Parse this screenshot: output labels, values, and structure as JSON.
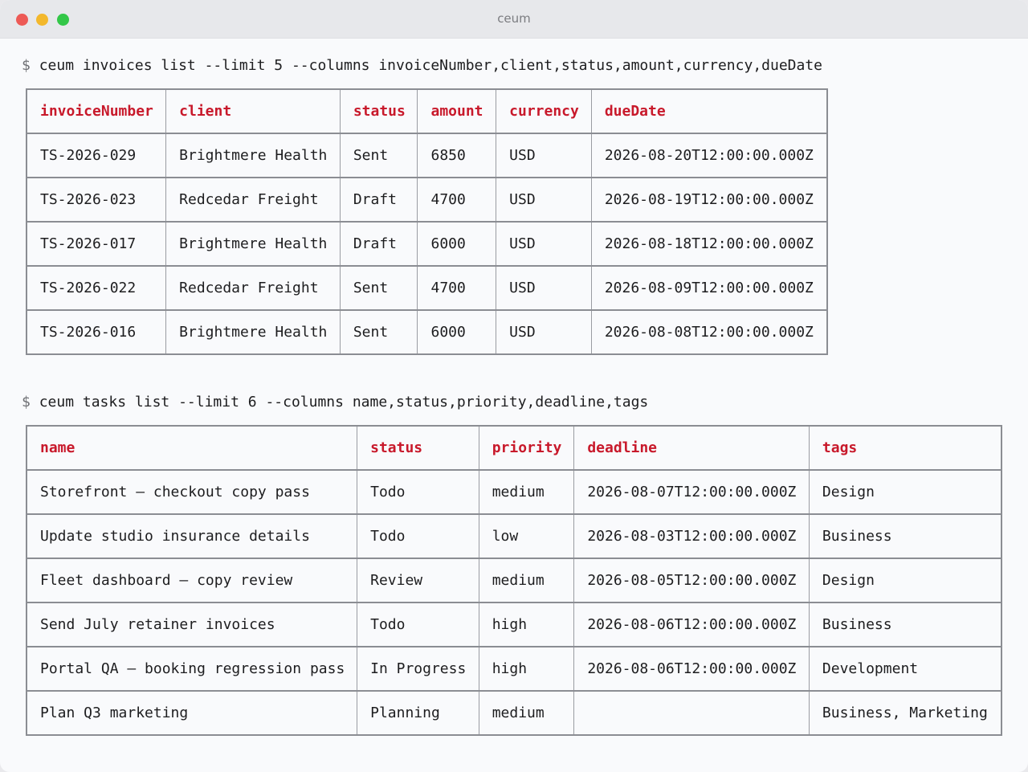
{
  "window": {
    "title": "ceum"
  },
  "commands": [
    {
      "prompt": "$",
      "command": "ceum invoices list --limit 5 --columns invoiceNumber,client,status,amount,currency,dueDate",
      "columns": [
        "invoiceNumber",
        "client",
        "status",
        "amount",
        "currency",
        "dueDate"
      ],
      "rows": [
        [
          "TS-2026-029",
          "Brightmere Health",
          "Sent",
          "6850",
          "USD",
          "2026-08-20T12:00:00.000Z"
        ],
        [
          "TS-2026-023",
          "Redcedar Freight",
          "Draft",
          "4700",
          "USD",
          "2026-08-19T12:00:00.000Z"
        ],
        [
          "TS-2026-017",
          "Brightmere Health",
          "Draft",
          "6000",
          "USD",
          "2026-08-18T12:00:00.000Z"
        ],
        [
          "TS-2026-022",
          "Redcedar Freight",
          "Sent",
          "4700",
          "USD",
          "2026-08-09T12:00:00.000Z"
        ],
        [
          "TS-2026-016",
          "Brightmere Health",
          "Sent",
          "6000",
          "USD",
          "2026-08-08T12:00:00.000Z"
        ]
      ]
    },
    {
      "prompt": "$",
      "command": "ceum tasks list --limit 6 --columns name,status,priority,deadline,tags",
      "columns": [
        "name",
        "status",
        "priority",
        "deadline",
        "tags"
      ],
      "rows": [
        [
          "Storefront — checkout copy pass",
          "Todo",
          "medium",
          "2026-08-07T12:00:00.000Z",
          "Design"
        ],
        [
          "Update studio insurance details",
          "Todo",
          "low",
          "2026-08-03T12:00:00.000Z",
          "Business"
        ],
        [
          "Fleet dashboard — copy review",
          "Review",
          "medium",
          "2026-08-05T12:00:00.000Z",
          "Design"
        ],
        [
          "Send July retainer invoices",
          "Todo",
          "high",
          "2026-08-06T12:00:00.000Z",
          "Business"
        ],
        [
          "Portal QA — booking regression pass",
          "In Progress",
          "high",
          "2026-08-06T12:00:00.000Z",
          "Development"
        ],
        [
          "Plan Q3 marketing",
          "Planning",
          "medium",
          "",
          "Business, Marketing"
        ]
      ]
    }
  ],
  "colors": {
    "header_text": "#c8192b",
    "border": "#8b8d93",
    "background": "#f9fafc"
  }
}
